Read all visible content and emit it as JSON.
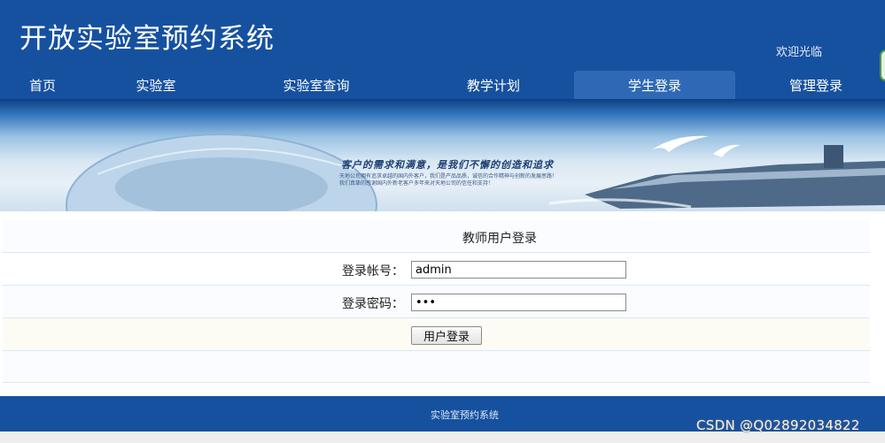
{
  "header": {
    "title": "开放实验室预约系统",
    "welcome": "欢迎光临"
  },
  "nav": {
    "home": "首页",
    "lab": "实验室",
    "lab_query": "实验室查询",
    "teaching_plan": "教学计划",
    "student_login": "学生登录",
    "admin_login": "管理登录"
  },
  "banner": {
    "slogan": "客户的需求和满意，是我们不懈的创造和追求",
    "sub1": "天地公司拥有追求卓越的国内外客户，我们是产品品质，诚信的合作精神与创新的发展思路！",
    "sub2": "我们真挚的感谢国内外新老客户多年来对天地公司的信任和支持！"
  },
  "form": {
    "title": "教师用户登录",
    "account_label": "登录帐号：",
    "account_value": "admin",
    "password_label": "登录密码：",
    "password_value": "•••",
    "submit_label": "用户登录"
  },
  "footer": {
    "text": "实验室预约系统"
  },
  "watermark": "CSDN @Q02892034822",
  "colors": {
    "header_bg": "#1651a0",
    "nav_active_bg": "#2f69b5",
    "footer_bg": "#1651a0"
  }
}
